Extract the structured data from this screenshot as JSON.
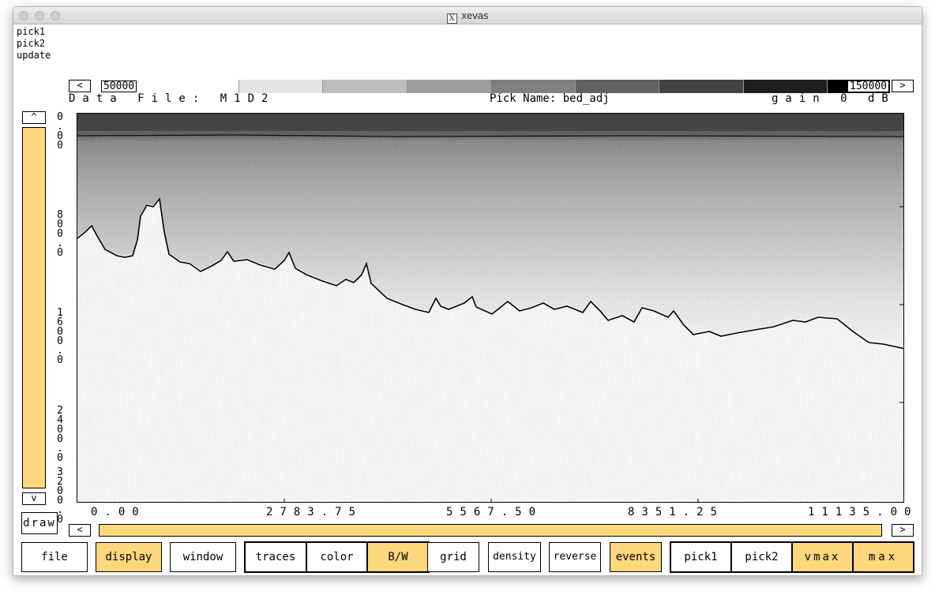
{
  "window": {
    "title": "xevas"
  },
  "menu": {
    "items": [
      "pick1",
      "pick2",
      "update"
    ]
  },
  "colorbar": {
    "min_label": "50000",
    "max_label": "150000",
    "prev": "<",
    "next": ">"
  },
  "info": {
    "data_file": "Data File: M1D2",
    "pick_name": "Pick Name: bed_adj",
    "gain": "gain 0 dB"
  },
  "vscroll": {
    "top_arrow": "^",
    "bottom_arrow": "v",
    "draw_label": "draw"
  },
  "yaxis": {
    "tick_labels": [
      "0.00",
      "800.0",
      "1600.0",
      "2400.0",
      "3200.0"
    ]
  },
  "xaxis": {
    "tick_labels": [
      "0.00",
      "2783.75",
      "5567.50",
      "8351.25",
      "11135.00"
    ]
  },
  "hscroll": {
    "prev": "<",
    "next": ">"
  },
  "buttons": {
    "file": "file",
    "display": "display",
    "window": "window",
    "traces": "traces",
    "color": "color",
    "bw": "B/W",
    "grid": "grid",
    "density": "density",
    "reverse": "reverse",
    "events": "events",
    "pick1": "pick1",
    "pick2": "pick2",
    "vmax": "vmax",
    "max": "max"
  },
  "colors": {
    "accent": "#fdd77b",
    "border": "#000000"
  }
}
